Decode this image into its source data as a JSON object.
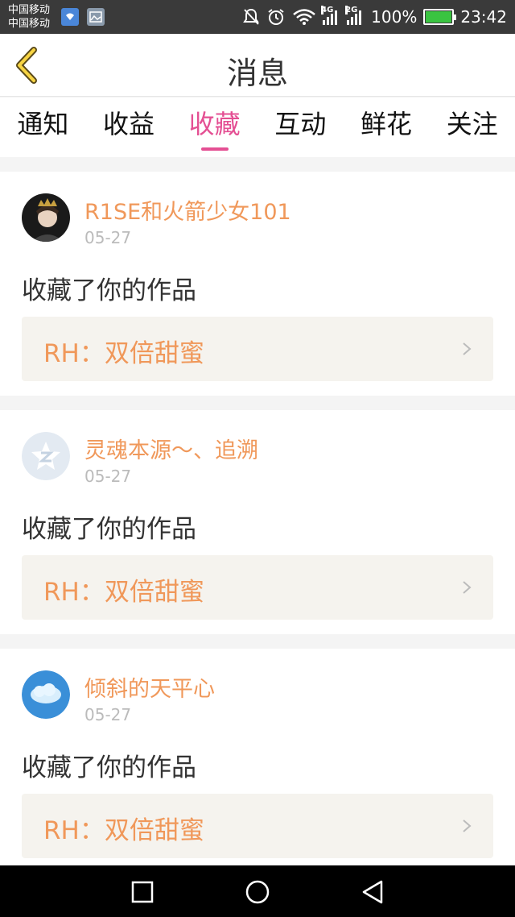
{
  "status_bar": {
    "carrier_1": "中国移动",
    "carrier_2": "中国移动",
    "net_4g": "4G",
    "net_2g": "2G",
    "battery": "100%",
    "battery_level": 1.0,
    "time": "23:42"
  },
  "header": {
    "title": "消息",
    "back_icon": "chevron-left-icon"
  },
  "tabs": [
    {
      "label": "通知"
    },
    {
      "label": "收益"
    },
    {
      "label": "收藏"
    },
    {
      "label": "互动"
    },
    {
      "label": "鲜花"
    },
    {
      "label": "关注"
    }
  ],
  "active_tab": "收藏",
  "notifications": [
    {
      "user": "R1SE和火箭少女101",
      "date": "05-27",
      "action": "收藏了你的作品",
      "work": "RH：双倍甜蜜"
    },
    {
      "user": "灵魂本源～、追溯",
      "date": "05-27",
      "action": "收藏了你的作品",
      "work": "RH：双倍甜蜜"
    },
    {
      "user": "倾斜的天平心",
      "date": "05-27",
      "action": "收藏了你的作品",
      "work": "RH：双倍甜蜜"
    }
  ],
  "colors": {
    "accent": "#e44f93",
    "name": "#f0985a",
    "work_bg": "#f5f3ee"
  }
}
